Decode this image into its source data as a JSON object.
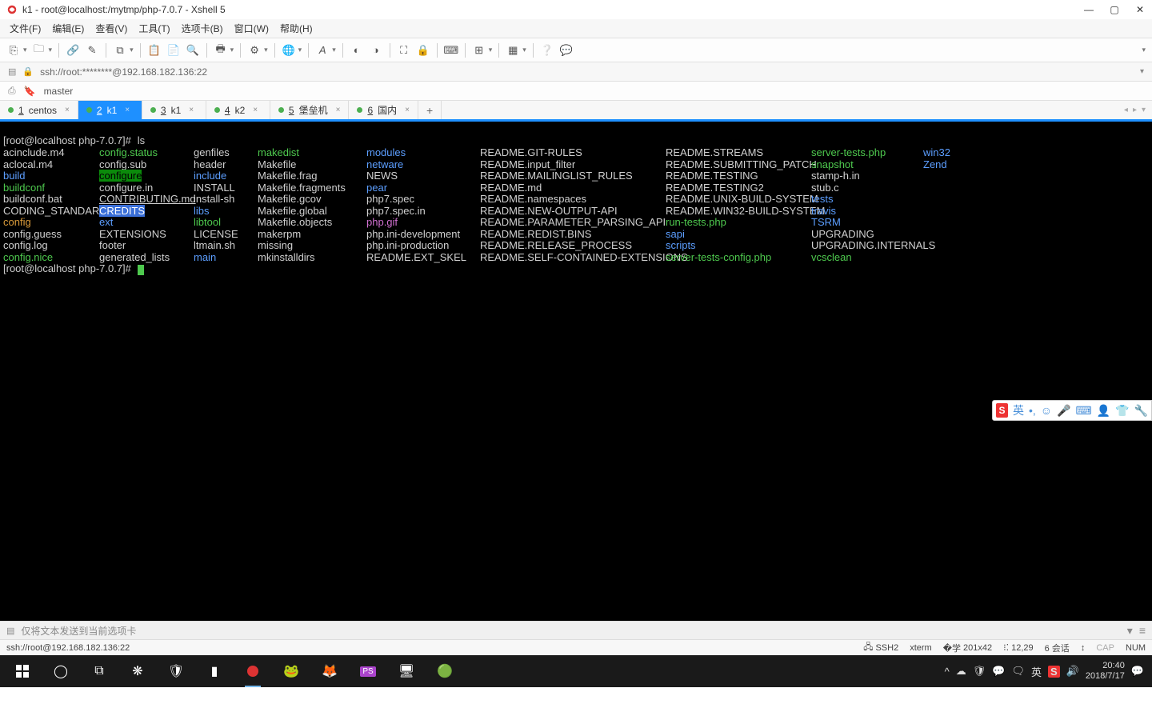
{
  "titlebar": {
    "title": "k1 - root@localhost:/mytmp/php-7.0.7 - Xshell 5"
  },
  "menubar": {
    "file": "文件(F)",
    "edit": "编辑(E)",
    "view": "查看(V)",
    "tools": "工具(T)",
    "tab": "选项卡(B)",
    "window": "窗口(W)",
    "help": "帮助(H)"
  },
  "addressbar": {
    "url": "ssh://root:********@192.168.182.136:22"
  },
  "secbar": {
    "master": "master"
  },
  "tabs": [
    {
      "num": "1",
      "label": "centos",
      "active": false
    },
    {
      "num": "2",
      "label": "k1",
      "active": true
    },
    {
      "num": "3",
      "label": "k1",
      "active": false
    },
    {
      "num": "4",
      "label": "k2",
      "active": false
    },
    {
      "num": "5",
      "label": "堡垒机",
      "active": false
    },
    {
      "num": "6",
      "label": "国内",
      "active": false
    }
  ],
  "terminal": {
    "prompt": "[root@localhost php-7.0.7]#",
    "command": "ls",
    "columns": [
      [
        {
          "t": "acinclude.m4",
          "c": "white"
        },
        {
          "t": "aclocal.m4",
          "c": "white"
        },
        {
          "t": "build",
          "c": "blue"
        },
        {
          "t": "buildconf",
          "c": "green"
        },
        {
          "t": "buildconf.bat",
          "c": "white"
        },
        {
          "t": "CODING_STANDARDS",
          "c": "white"
        },
        {
          "t": "config",
          "c": "orange"
        },
        {
          "t": "config.guess",
          "c": "white"
        },
        {
          "t": "config.log",
          "c": "white"
        },
        {
          "t": "config.nice",
          "c": "green"
        }
      ],
      [
        {
          "t": "config.status",
          "c": "green"
        },
        {
          "t": "config.sub",
          "c": "white"
        },
        {
          "t": "configure",
          "c": "white",
          "bg": "green"
        },
        {
          "t": "configure.in",
          "c": "white"
        },
        {
          "t": "CONTRIBUTING.md",
          "c": "white",
          "strike": true
        },
        {
          "t": "CREDITS",
          "c": "white",
          "bg": "blue"
        },
        {
          "t": "ext",
          "c": "blue"
        },
        {
          "t": "EXTENSIONS",
          "c": "white"
        },
        {
          "t": "footer",
          "c": "white"
        },
        {
          "t": "generated_lists",
          "c": "white"
        }
      ],
      [
        {
          "t": "genfiles",
          "c": "white"
        },
        {
          "t": "header",
          "c": "white"
        },
        {
          "t": "include",
          "c": "blue"
        },
        {
          "t": "INSTALL",
          "c": "white"
        },
        {
          "t": "install-sh",
          "c": "white"
        },
        {
          "t": "libs",
          "c": "blue"
        },
        {
          "t": "libtool",
          "c": "green"
        },
        {
          "t": "LICENSE",
          "c": "white"
        },
        {
          "t": "ltmain.sh",
          "c": "white"
        },
        {
          "t": "main",
          "c": "blue"
        }
      ],
      [
        {
          "t": "makedist",
          "c": "green"
        },
        {
          "t": "Makefile",
          "c": "white"
        },
        {
          "t": "Makefile.frag",
          "c": "white"
        },
        {
          "t": "Makefile.fragments",
          "c": "white"
        },
        {
          "t": "Makefile.gcov",
          "c": "white"
        },
        {
          "t": "Makefile.global",
          "c": "white"
        },
        {
          "t": "Makefile.objects",
          "c": "white"
        },
        {
          "t": "makerpm",
          "c": "white"
        },
        {
          "t": "missing",
          "c": "white"
        },
        {
          "t": "mkinstalldirs",
          "c": "white"
        }
      ],
      [
        {
          "t": "modules",
          "c": "blue"
        },
        {
          "t": "netware",
          "c": "blue"
        },
        {
          "t": "NEWS",
          "c": "white"
        },
        {
          "t": "pear",
          "c": "blue"
        },
        {
          "t": "php7.spec",
          "c": "white"
        },
        {
          "t": "php7.spec.in",
          "c": "white"
        },
        {
          "t": "php.gif",
          "c": "magenta"
        },
        {
          "t": "php.ini-development",
          "c": "white"
        },
        {
          "t": "php.ini-production",
          "c": "white"
        },
        {
          "t": "README.EXT_SKEL",
          "c": "white"
        }
      ],
      [
        {
          "t": "README.GIT-RULES",
          "c": "white"
        },
        {
          "t": "README.input_filter",
          "c": "white"
        },
        {
          "t": "README.MAILINGLIST_RULES",
          "c": "white"
        },
        {
          "t": "README.md",
          "c": "white"
        },
        {
          "t": "README.namespaces",
          "c": "white"
        },
        {
          "t": "README.NEW-OUTPUT-API",
          "c": "white"
        },
        {
          "t": "README.PARAMETER_PARSING_API",
          "c": "white"
        },
        {
          "t": "README.REDIST.BINS",
          "c": "white"
        },
        {
          "t": "README.RELEASE_PROCESS",
          "c": "white"
        },
        {
          "t": "README.SELF-CONTAINED-EXTENSIONS",
          "c": "white"
        }
      ],
      [
        {
          "t": "README.STREAMS",
          "c": "white"
        },
        {
          "t": "README.SUBMITTING_PATCH",
          "c": "white"
        },
        {
          "t": "README.TESTING",
          "c": "white"
        },
        {
          "t": "README.TESTING2",
          "c": "white"
        },
        {
          "t": "README.UNIX-BUILD-SYSTEM",
          "c": "white"
        },
        {
          "t": "README.WIN32-BUILD-SYSTEM",
          "c": "white"
        },
        {
          "t": "run-tests.php",
          "c": "green"
        },
        {
          "t": "sapi",
          "c": "blue"
        },
        {
          "t": "scripts",
          "c": "blue"
        },
        {
          "t": "server-tests-config.php",
          "c": "green"
        }
      ],
      [
        {
          "t": "server-tests.php",
          "c": "green"
        },
        {
          "t": "snapshot",
          "c": "green"
        },
        {
          "t": "stamp-h.in",
          "c": "white"
        },
        {
          "t": "stub.c",
          "c": "white"
        },
        {
          "t": "tests",
          "c": "blue"
        },
        {
          "t": "travis",
          "c": "blue"
        },
        {
          "t": "TSRM",
          "c": "blue"
        },
        {
          "t": "UPGRADING",
          "c": "white"
        },
        {
          "t": "UPGRADING.INTERNALS",
          "c": "white"
        },
        {
          "t": "vcsclean",
          "c": "green"
        }
      ],
      [
        {
          "t": "win32",
          "c": "blue"
        },
        {
          "t": "Zend",
          "c": "blue"
        },
        {
          "t": "",
          "c": "white"
        },
        {
          "t": "",
          "c": "white"
        },
        {
          "t": "",
          "c": "white"
        },
        {
          "t": "",
          "c": "white"
        },
        {
          "t": "",
          "c": "white"
        },
        {
          "t": "",
          "c": "white"
        },
        {
          "t": "",
          "c": "white"
        },
        {
          "t": "",
          "c": "white"
        }
      ]
    ]
  },
  "inputbar": {
    "placeholder": "仅将文本发送到当前选项卡"
  },
  "statusbar": {
    "left": "ssh://root@192.168.182.136:22",
    "ssh": "SSH2",
    "term": "xterm",
    "size": "201x42",
    "pos": "12,29",
    "sess": "6 会话",
    "cap": "CAP",
    "num": "NUM"
  },
  "ime": {
    "lang": "英"
  },
  "taskbar": {
    "time": "20:40",
    "date": "2018/7/17",
    "langbadge": "英"
  }
}
